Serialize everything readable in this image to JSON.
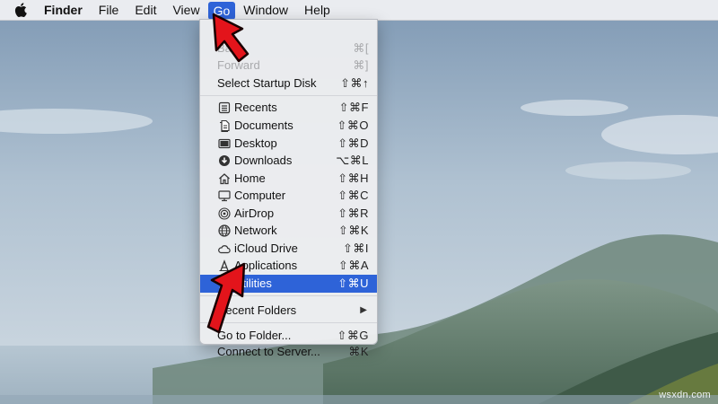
{
  "menubar": {
    "items": [
      {
        "label": "Finder"
      },
      {
        "label": "File"
      },
      {
        "label": "Edit"
      },
      {
        "label": "View"
      },
      {
        "label": "Go"
      },
      {
        "label": "Window"
      },
      {
        "label": "Help"
      }
    ],
    "active_item": "Go"
  },
  "go_menu": {
    "top_items": [
      {
        "label": "Back",
        "shortcut": "⌘[",
        "disabled": true
      },
      {
        "label": "Forward",
        "shortcut": "⌘]",
        "disabled": true
      },
      {
        "label": "Select Startup Disk",
        "shortcut": "⇧⌘↑",
        "disabled": false
      }
    ],
    "places": [
      {
        "label": "Recents",
        "shortcut": "⇧⌘F",
        "icon": "recents-icon"
      },
      {
        "label": "Documents",
        "shortcut": "⇧⌘O",
        "icon": "documents-icon"
      },
      {
        "label": "Desktop",
        "shortcut": "⇧⌘D",
        "icon": "desktop-icon"
      },
      {
        "label": "Downloads",
        "shortcut": "⌥⌘L",
        "icon": "downloads-icon"
      },
      {
        "label": "Home",
        "shortcut": "⇧⌘H",
        "icon": "home-icon"
      },
      {
        "label": "Computer",
        "shortcut": "⇧⌘C",
        "icon": "computer-icon"
      },
      {
        "label": "AirDrop",
        "shortcut": "⇧⌘R",
        "icon": "airdrop-icon"
      },
      {
        "label": "Network",
        "shortcut": "⇧⌘K",
        "icon": "network-icon"
      },
      {
        "label": "iCloud Drive",
        "shortcut": "⇧⌘I",
        "icon": "icloud-icon"
      },
      {
        "label": "Applications",
        "shortcut": "⇧⌘A",
        "icon": "applications-icon"
      },
      {
        "label": "Utilities",
        "shortcut": "⇧⌘U",
        "icon": "utilities-icon",
        "highlighted": true
      }
    ],
    "recent_folders": {
      "label": "Recent Folders"
    },
    "bottom_items": [
      {
        "label": "Go to Folder...",
        "shortcut": "⇧⌘G"
      },
      {
        "label": "Connect to Server...",
        "shortcut": "⌘K"
      }
    ]
  },
  "colors": {
    "highlight": "#2e63d8",
    "arrow_red": "#e3141b"
  },
  "watermark": "wsxdn.com"
}
